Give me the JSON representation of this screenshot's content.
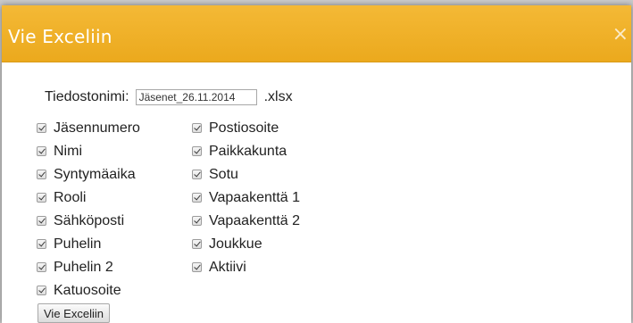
{
  "dialog": {
    "title": "Vie Exceliin",
    "close_label": "×"
  },
  "filename": {
    "label": "Tiedostonimi:",
    "value": "Jäsenet_26.11.2014",
    "extension": ".xlsx"
  },
  "columns": [
    [
      "Jäsennumero",
      "Nimi",
      "Syntymäaika",
      "Rooli",
      "Sähköposti",
      "Puhelin",
      "Puhelin 2",
      "Katuosoite"
    ],
    [
      "Postiosoite",
      "Paikkakunta",
      "Sotu",
      "Vapaakenttä 1",
      "Vapaakenttä 2",
      "Joukkue",
      "Aktiivi"
    ]
  ],
  "export_button": "Vie Exceliin"
}
